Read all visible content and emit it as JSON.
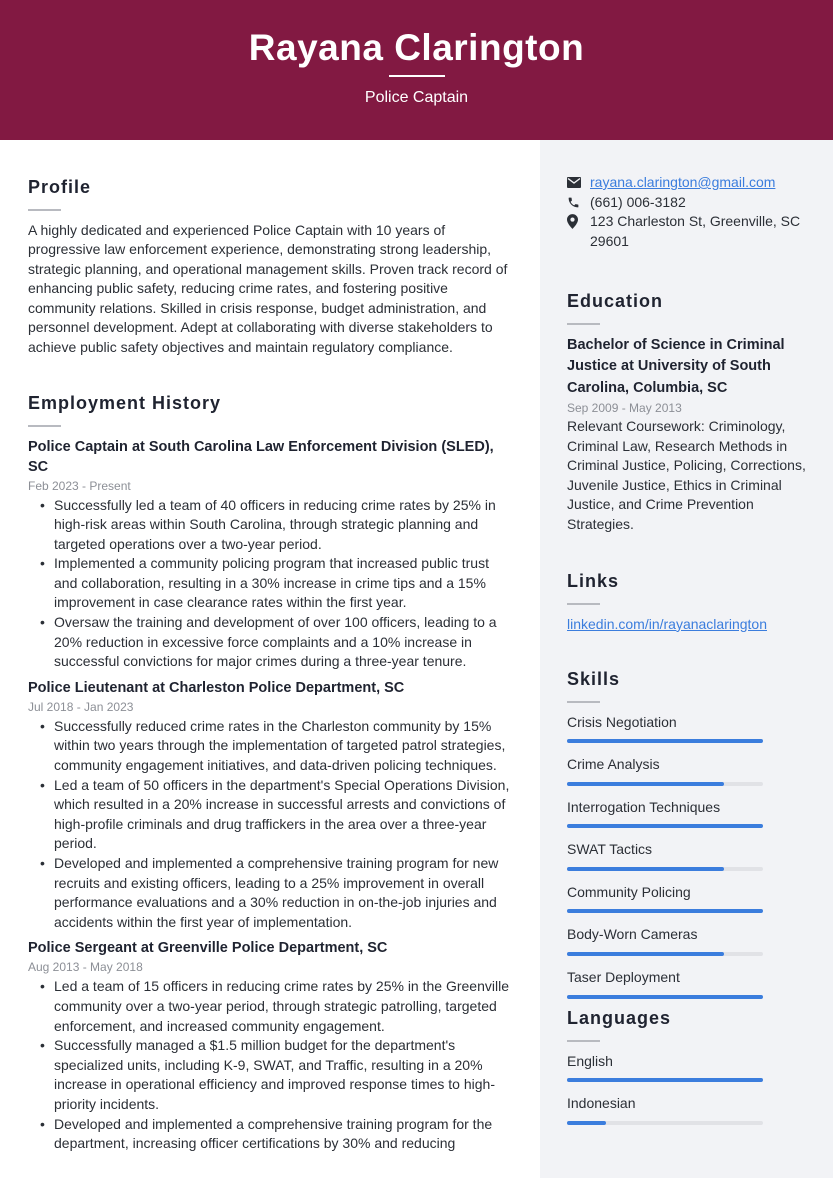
{
  "header": {
    "name": "Rayana Clarington",
    "title": "Police Captain",
    "background_color": "#821942"
  },
  "profile": {
    "heading": "Profile",
    "text": "A highly dedicated and experienced Police Captain with 10 years of progressive law enforcement experience, demonstrating strong leadership, strategic planning, and operational management skills. Proven track record of enhancing public safety, reducing crime rates, and fostering positive community relations. Skilled in crisis response, budget administration, and personnel development. Adept at collaborating with diverse stakeholders to achieve public safety objectives and maintain regulatory compliance."
  },
  "employment": {
    "heading": "Employment History",
    "jobs": [
      {
        "title": "Police Captain at South Carolina Law Enforcement Division (SLED), SC",
        "dates": "Feb 2023 - Present",
        "bullets": [
          "Successfully led a team of 40 officers in reducing crime rates by 25% in high-risk areas within South Carolina, through strategic planning and targeted operations over a two-year period.",
          "Implemented a community policing program that increased public trust and collaboration, resulting in a 30% increase in crime tips and a 15% improvement in case clearance rates within the first year.",
          "Oversaw the training and development of over 100 officers, leading to a 20% reduction in excessive force complaints and a 10% increase in successful convictions for major crimes during a three-year tenure."
        ]
      },
      {
        "title": "Police Lieutenant at Charleston Police Department, SC",
        "dates": "Jul 2018 - Jan 2023",
        "bullets": [
          "Successfully reduced crime rates in the Charleston community by 15% within two years through the implementation of targeted patrol strategies, community engagement initiatives, and data-driven policing techniques.",
          "Led a team of 50 officers in the department's Special Operations Division, which resulted in a 20% increase in successful arrests and convictions of high-profile criminals and drug traffickers in the area over a three-year period.",
          "Developed and implemented a comprehensive training program for new recruits and existing officers, leading to a 25% improvement in overall performance evaluations and a 30% reduction in on-the-job injuries and accidents within the first year of implementation."
        ]
      },
      {
        "title": "Police Sergeant at Greenville Police Department, SC",
        "dates": "Aug 2013 - May 2018",
        "bullets": [
          "Led a team of 15 officers in reducing crime rates by 25% in the Greenville community over a two-year period, through strategic patrolling, targeted enforcement, and increased community engagement.",
          "Successfully managed a $1.5 million budget for the department's specialized units, including K-9, SWAT, and Traffic, resulting in a 20% increase in operational efficiency and improved response times to high-priority incidents.",
          "Developed and implemented a comprehensive training program for the department, increasing officer certifications by 30% and reducing"
        ]
      }
    ]
  },
  "contact": {
    "email": "rayana.clarington@gmail.com",
    "phone": "(661) 006-3182",
    "address": "123 Charleston St, Greenville, SC 29601",
    "icons": [
      "envelope-icon",
      "phone-icon",
      "map-pin-icon"
    ]
  },
  "education": {
    "heading": "Education",
    "degree": "Bachelor of Science in Criminal Justice at University of South Carolina, Columbia, SC",
    "dates": "Sep 2009 - May 2013",
    "description": "Relevant Coursework: Criminology, Criminal Law, Research Methods in Criminal Justice, Policing, Corrections, Juvenile Justice, Ethics in Criminal Justice, and Crime Prevention Strategies."
  },
  "links": {
    "heading": "Links",
    "items": [
      {
        "label": "linkedin.com/in/rayanaclarington"
      }
    ]
  },
  "skills": {
    "heading": "Skills",
    "bar_color": "#3b7ddd",
    "items": [
      {
        "name": "Crisis Negotiation",
        "level": 1.0
      },
      {
        "name": "Crime Analysis",
        "level": 0.8
      },
      {
        "name": "Interrogation Techniques",
        "level": 1.0
      },
      {
        "name": "SWAT Tactics",
        "level": 0.8
      },
      {
        "name": "Community Policing",
        "level": 1.0
      },
      {
        "name": "Body-Worn Cameras",
        "level": 0.8
      },
      {
        "name": "Taser Deployment",
        "level": 1.0
      }
    ]
  },
  "languages": {
    "heading": "Languages",
    "items": [
      {
        "name": "English",
        "level": 1.0
      },
      {
        "name": "Indonesian",
        "level": 0.2
      }
    ]
  }
}
